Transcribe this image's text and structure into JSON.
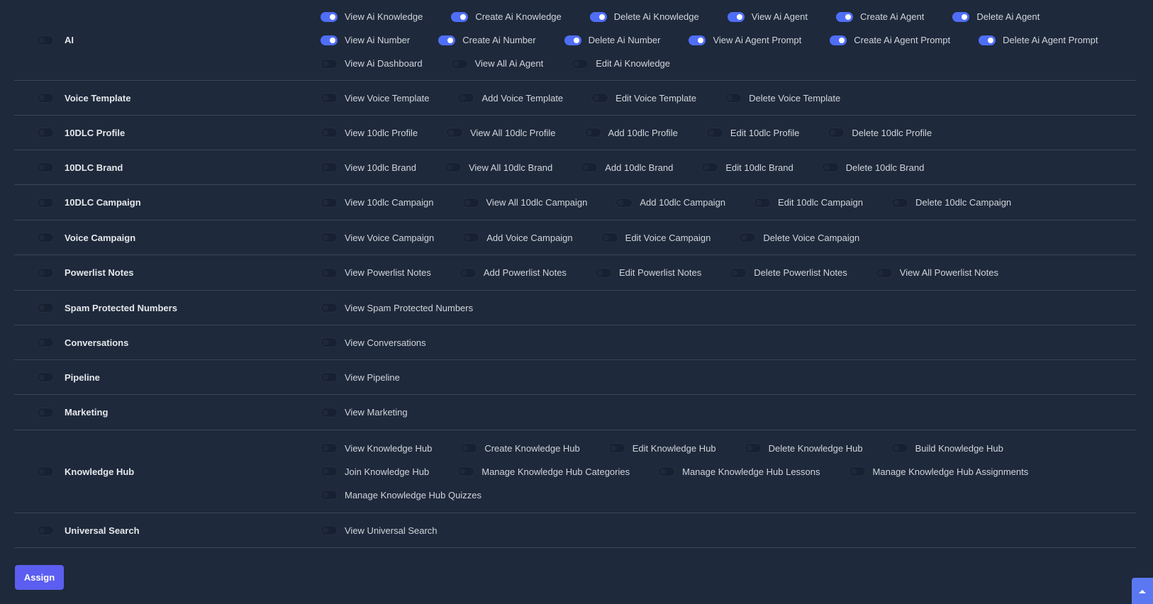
{
  "modules": [
    {
      "name": "AI",
      "enabled": false,
      "permission_lines": [
        [
          {
            "label": "View Ai Knowledge",
            "enabled": true
          },
          {
            "label": "Create Ai Knowledge",
            "enabled": true
          },
          {
            "label": "Delete Ai Knowledge",
            "enabled": true
          },
          {
            "label": "View Ai Agent",
            "enabled": true
          },
          {
            "label": "Create Ai Agent",
            "enabled": true
          },
          {
            "label": "Delete Ai Agent",
            "enabled": true
          }
        ],
        [
          {
            "label": "View Ai Number",
            "enabled": true
          },
          {
            "label": "Create Ai Number",
            "enabled": true
          },
          {
            "label": "Delete Ai Number",
            "enabled": true
          },
          {
            "label": "View Ai Agent Prompt",
            "enabled": true
          },
          {
            "label": "Create Ai Agent Prompt",
            "enabled": true
          },
          {
            "label": "Delete Ai Agent Prompt",
            "enabled": true
          }
        ],
        [
          {
            "label": "View Ai Dashboard",
            "enabled": false
          },
          {
            "label": "View All Ai Agent",
            "enabled": false
          },
          {
            "label": "Edit Ai Knowledge",
            "enabled": false
          }
        ]
      ]
    },
    {
      "name": "Voice Template",
      "enabled": false,
      "permission_lines": [
        [
          {
            "label": "View Voice Template",
            "enabled": false
          },
          {
            "label": "Add Voice Template",
            "enabled": false
          },
          {
            "label": "Edit Voice Template",
            "enabled": false
          },
          {
            "label": "Delete Voice Template",
            "enabled": false
          }
        ]
      ]
    },
    {
      "name": "10DLC Profile",
      "enabled": false,
      "permission_lines": [
        [
          {
            "label": "View 10dlc Profile",
            "enabled": false
          },
          {
            "label": "View All 10dlc Profile",
            "enabled": false
          },
          {
            "label": "Add 10dlc Profile",
            "enabled": false
          },
          {
            "label": "Edit 10dlc Profile",
            "enabled": false
          },
          {
            "label": "Delete 10dlc Profile",
            "enabled": false
          }
        ]
      ]
    },
    {
      "name": "10DLC Brand",
      "enabled": false,
      "permission_lines": [
        [
          {
            "label": "View 10dlc Brand",
            "enabled": false
          },
          {
            "label": "View All 10dlc Brand",
            "enabled": false
          },
          {
            "label": "Add 10dlc Brand",
            "enabled": false
          },
          {
            "label": "Edit 10dlc Brand",
            "enabled": false
          },
          {
            "label": "Delete 10dlc Brand",
            "enabled": false
          }
        ]
      ]
    },
    {
      "name": "10DLC Campaign",
      "enabled": false,
      "permission_lines": [
        [
          {
            "label": "View 10dlc Campaign",
            "enabled": false
          },
          {
            "label": "View All 10dlc Campaign",
            "enabled": false
          },
          {
            "label": "Add 10dlc Campaign",
            "enabled": false
          },
          {
            "label": "Edit 10dlc Campaign",
            "enabled": false
          },
          {
            "label": "Delete 10dlc Campaign",
            "enabled": false
          }
        ]
      ]
    },
    {
      "name": "Voice Campaign",
      "enabled": false,
      "permission_lines": [
        [
          {
            "label": "View Voice Campaign",
            "enabled": false
          },
          {
            "label": "Add Voice Campaign",
            "enabled": false
          },
          {
            "label": "Edit Voice Campaign",
            "enabled": false
          },
          {
            "label": "Delete Voice Campaign",
            "enabled": false
          }
        ]
      ]
    },
    {
      "name": "Powerlist Notes",
      "enabled": false,
      "permission_lines": [
        [
          {
            "label": "View Powerlist Notes",
            "enabled": false
          },
          {
            "label": "Add Powerlist Notes",
            "enabled": false
          },
          {
            "label": "Edit Powerlist Notes",
            "enabled": false
          },
          {
            "label": "Delete Powerlist Notes",
            "enabled": false
          },
          {
            "label": "View All Powerlist Notes",
            "enabled": false
          }
        ]
      ]
    },
    {
      "name": "Spam Protected Numbers",
      "enabled": false,
      "permission_lines": [
        [
          {
            "label": "View Spam Protected Numbers",
            "enabled": false
          }
        ]
      ]
    },
    {
      "name": "Conversations",
      "enabled": false,
      "permission_lines": [
        [
          {
            "label": "View Conversations",
            "enabled": false
          }
        ]
      ]
    },
    {
      "name": "Pipeline",
      "enabled": false,
      "permission_lines": [
        [
          {
            "label": "View Pipeline",
            "enabled": false
          }
        ]
      ]
    },
    {
      "name": "Marketing",
      "enabled": false,
      "permission_lines": [
        [
          {
            "label": "View Marketing",
            "enabled": false
          }
        ]
      ]
    },
    {
      "name": "Knowledge Hub",
      "enabled": false,
      "permission_lines": [
        [
          {
            "label": "View Knowledge Hub",
            "enabled": false
          },
          {
            "label": "Create Knowledge Hub",
            "enabled": false
          },
          {
            "label": "Edit Knowledge Hub",
            "enabled": false
          },
          {
            "label": "Delete Knowledge Hub",
            "enabled": false
          },
          {
            "label": "Build Knowledge Hub",
            "enabled": false
          }
        ],
        [
          {
            "label": "Join Knowledge Hub",
            "enabled": false
          },
          {
            "label": "Manage Knowledge Hub Categories",
            "enabled": false
          },
          {
            "label": "Manage Knowledge Hub Lessons",
            "enabled": false
          },
          {
            "label": "Manage Knowledge Hub Assignments",
            "enabled": false
          }
        ],
        [
          {
            "label": "Manage Knowledge Hub Quizzes",
            "enabled": false
          }
        ]
      ]
    },
    {
      "name": "Universal Search",
      "enabled": false,
      "permission_lines": [
        [
          {
            "label": "View Universal Search",
            "enabled": false
          }
        ]
      ]
    }
  ],
  "actions": {
    "assign_label": "Assign"
  },
  "scroll_top_icon": "chevron-up-icon",
  "colors": {
    "background": "#1e293b",
    "toggle_on": "#4f6ef7",
    "toggle_off": "#182131",
    "assign_button": "#5b5ef0",
    "divider": "#3a4559"
  }
}
